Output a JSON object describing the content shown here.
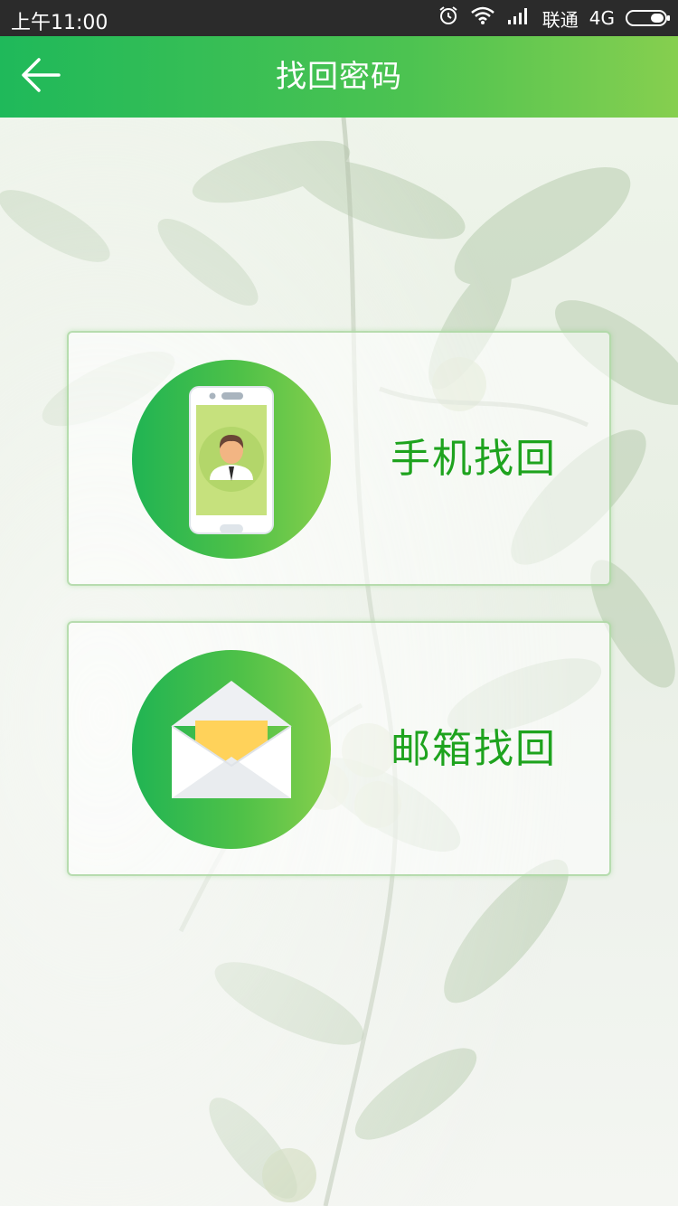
{
  "status_bar": {
    "time": "上午11:00",
    "carrier": "联通",
    "network": "4G",
    "icons": [
      "alarm-icon",
      "wifi-icon",
      "signal-icon",
      "battery-icon"
    ]
  },
  "header": {
    "title": "找回密码",
    "back_icon": "arrow-left-icon"
  },
  "options": {
    "phone": {
      "label": "手机找回",
      "icon": "phone-user-icon"
    },
    "email": {
      "label": "邮箱找回",
      "icon": "envelope-icon"
    }
  },
  "colors": {
    "header_gradient_start": "#1fb95a",
    "header_gradient_end": "#86cf4f",
    "label_green": "#1ea31e",
    "status_bar_bg": "#2b2b2b"
  }
}
